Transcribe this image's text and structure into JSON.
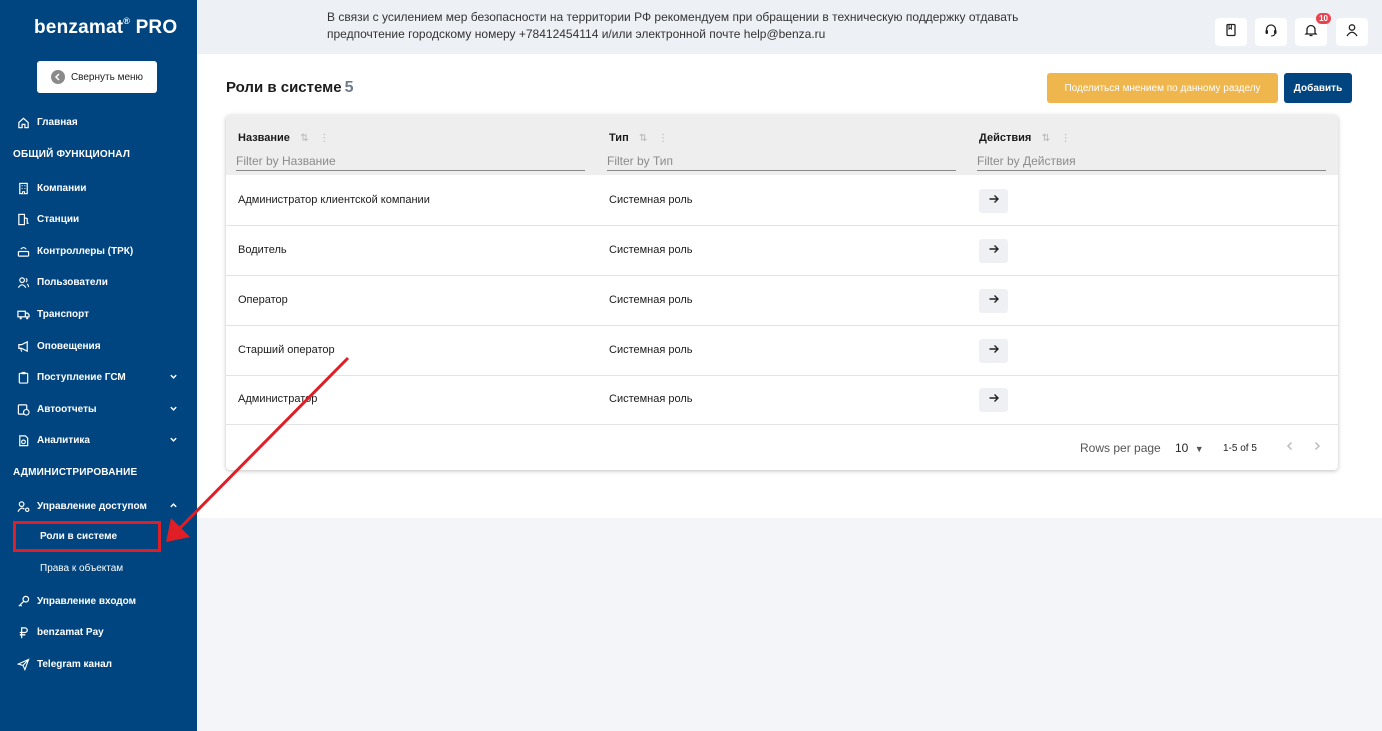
{
  "brand": {
    "name": "benzamat",
    "suffix": "PRO",
    "registered": "®"
  },
  "sidebar": {
    "collapse_label": "Свернуть меню",
    "home": "Главная",
    "section_general": "ОБЩИЙ ФУНКЦИОНАЛ",
    "items": [
      {
        "label": "Компании",
        "icon": "building-icon"
      },
      {
        "label": "Станции",
        "icon": "fuel-station-icon"
      },
      {
        "label": "Контроллеры (ТРК)",
        "icon": "controller-icon"
      },
      {
        "label": "Пользователи",
        "icon": "users-icon"
      },
      {
        "label": "Транспорт",
        "icon": "truck-icon"
      },
      {
        "label": "Оповещения",
        "icon": "megaphone-icon"
      },
      {
        "label": "Поступление ГСМ",
        "icon": "clipboard-icon"
      },
      {
        "label": "Автоотчеты",
        "icon": "clock-report-icon"
      },
      {
        "label": "Аналитика",
        "icon": "analytics-icon"
      }
    ],
    "section_admin": "АДМИНИСТРИРОВАНИЕ",
    "access_control": "Управление доступом",
    "sub_items": [
      "Роли в системе",
      "Права к объектам"
    ],
    "login_control": "Управление входом",
    "pay": "benzamat Pay",
    "telegram": "Telegram канал"
  },
  "header": {
    "notice_line1": "В связи с усилением мер безопасности на территории РФ рекомендуем при обращении в техническую поддержку отдавать",
    "notice_line2": "предпочтение городскому номеру +78412454114 и/или электронной почте help@benza.ru",
    "notifications_count": "10"
  },
  "page": {
    "title": "Роли в системе",
    "count": "5",
    "share_button": "Поделиться мнением по данному разделу",
    "add_button": "Добавить"
  },
  "table": {
    "columns": [
      {
        "label": "Название",
        "filter_placeholder": "Filter by Название"
      },
      {
        "label": "Тип",
        "filter_placeholder": "Filter by Тип"
      },
      {
        "label": "Действия",
        "filter_placeholder": "Filter by Действия"
      }
    ],
    "rows": [
      {
        "name": "Администратор клиентской компании",
        "type": "Системная роль"
      },
      {
        "name": "Водитель",
        "type": "Системная роль"
      },
      {
        "name": "Оператор",
        "type": "Системная роль"
      },
      {
        "name": "Старший оператор",
        "type": "Системная роль"
      },
      {
        "name": "Администратор",
        "type": "Системная роль"
      }
    ],
    "rows_per_page_label": "Rows per page",
    "rows_per_page_value": "10",
    "range": "1-5 of 5"
  },
  "colors": {
    "sidebar": "#00457f",
    "accent": "#f0b64e",
    "highlight": "#e01e26",
    "badge": "#e8434f"
  }
}
